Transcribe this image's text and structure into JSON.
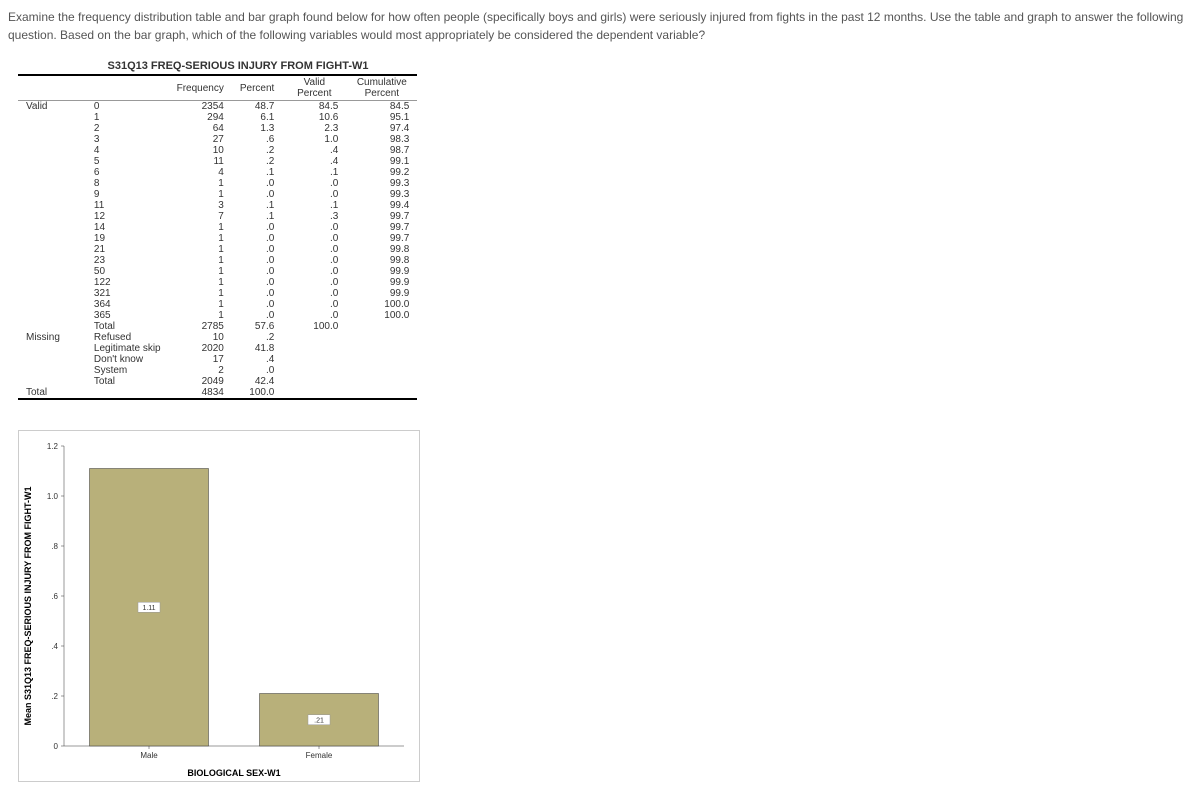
{
  "question": "Examine the frequency distribution table and bar graph found below for how often people (specifically boys and girls) were seriously injured from fights in the past 12 months. Use the table and graph to answer the following question. Based on the bar graph, which of the following variables would most appropriately be considered the dependent variable?",
  "table": {
    "title": "S31Q13 FREQ-SERIOUS INJURY FROM FIGHT-W1",
    "headers": {
      "col1": "",
      "col2": "",
      "freq": "Frequency",
      "pct": "Percent",
      "vpct": "Valid Percent",
      "cpct": "Cumulative Percent"
    },
    "valid_label": "Valid",
    "valid_rows": [
      {
        "cat": "0",
        "freq": "2354",
        "pct": "48.7",
        "vpct": "84.5",
        "cpct": "84.5"
      },
      {
        "cat": "1",
        "freq": "294",
        "pct": "6.1",
        "vpct": "10.6",
        "cpct": "95.1"
      },
      {
        "cat": "2",
        "freq": "64",
        "pct": "1.3",
        "vpct": "2.3",
        "cpct": "97.4"
      },
      {
        "cat": "3",
        "freq": "27",
        "pct": ".6",
        "vpct": "1.0",
        "cpct": "98.3"
      },
      {
        "cat": "4",
        "freq": "10",
        "pct": ".2",
        "vpct": ".4",
        "cpct": "98.7"
      },
      {
        "cat": "5",
        "freq": "11",
        "pct": ".2",
        "vpct": ".4",
        "cpct": "99.1"
      },
      {
        "cat": "6",
        "freq": "4",
        "pct": ".1",
        "vpct": ".1",
        "cpct": "99.2"
      },
      {
        "cat": "8",
        "freq": "1",
        "pct": ".0",
        "vpct": ".0",
        "cpct": "99.3"
      },
      {
        "cat": "9",
        "freq": "1",
        "pct": ".0",
        "vpct": ".0",
        "cpct": "99.3"
      },
      {
        "cat": "11",
        "freq": "3",
        "pct": ".1",
        "vpct": ".1",
        "cpct": "99.4"
      },
      {
        "cat": "12",
        "freq": "7",
        "pct": ".1",
        "vpct": ".3",
        "cpct": "99.7"
      },
      {
        "cat": "14",
        "freq": "1",
        "pct": ".0",
        "vpct": ".0",
        "cpct": "99.7"
      },
      {
        "cat": "19",
        "freq": "1",
        "pct": ".0",
        "vpct": ".0",
        "cpct": "99.7"
      },
      {
        "cat": "21",
        "freq": "1",
        "pct": ".0",
        "vpct": ".0",
        "cpct": "99.8"
      },
      {
        "cat": "23",
        "freq": "1",
        "pct": ".0",
        "vpct": ".0",
        "cpct": "99.8"
      },
      {
        "cat": "50",
        "freq": "1",
        "pct": ".0",
        "vpct": ".0",
        "cpct": "99.9"
      },
      {
        "cat": "122",
        "freq": "1",
        "pct": ".0",
        "vpct": ".0",
        "cpct": "99.9"
      },
      {
        "cat": "321",
        "freq": "1",
        "pct": ".0",
        "vpct": ".0",
        "cpct": "99.9"
      },
      {
        "cat": "364",
        "freq": "1",
        "pct": ".0",
        "vpct": ".0",
        "cpct": "100.0"
      },
      {
        "cat": "365",
        "freq": "1",
        "pct": ".0",
        "vpct": ".0",
        "cpct": "100.0"
      },
      {
        "cat": "Total",
        "freq": "2785",
        "pct": "57.6",
        "vpct": "100.0",
        "cpct": ""
      }
    ],
    "missing_label": "Missing",
    "missing_rows": [
      {
        "cat": "Refused",
        "freq": "10",
        "pct": ".2",
        "vpct": "",
        "cpct": ""
      },
      {
        "cat": "Legitimate skip",
        "freq": "2020",
        "pct": "41.8",
        "vpct": "",
        "cpct": ""
      },
      {
        "cat": "Don't know",
        "freq": "17",
        "pct": ".4",
        "vpct": "",
        "cpct": ""
      },
      {
        "cat": "System",
        "freq": "2",
        "pct": ".0",
        "vpct": "",
        "cpct": ""
      },
      {
        "cat": "Total",
        "freq": "2049",
        "pct": "42.4",
        "vpct": "",
        "cpct": ""
      }
    ],
    "total_label": "Total",
    "total_row": {
      "freq": "4834",
      "pct": "100.0",
      "vpct": "",
      "cpct": ""
    }
  },
  "chart_data": {
    "type": "bar",
    "categories": [
      "Male",
      "Female"
    ],
    "values": [
      1.11,
      0.21
    ],
    "xlabel": "BIOLOGICAL SEX-W1",
    "ylabel": "Mean S31Q13 FREQ-SERIOUS INJURY FROM FIGHT-W1",
    "ylim": [
      0,
      1.2
    ],
    "yticks": [
      "0",
      ".2",
      ".4",
      ".6",
      ".8",
      "1.0",
      "1.2"
    ],
    "bar_labels": [
      "1.11",
      ".21"
    ]
  }
}
